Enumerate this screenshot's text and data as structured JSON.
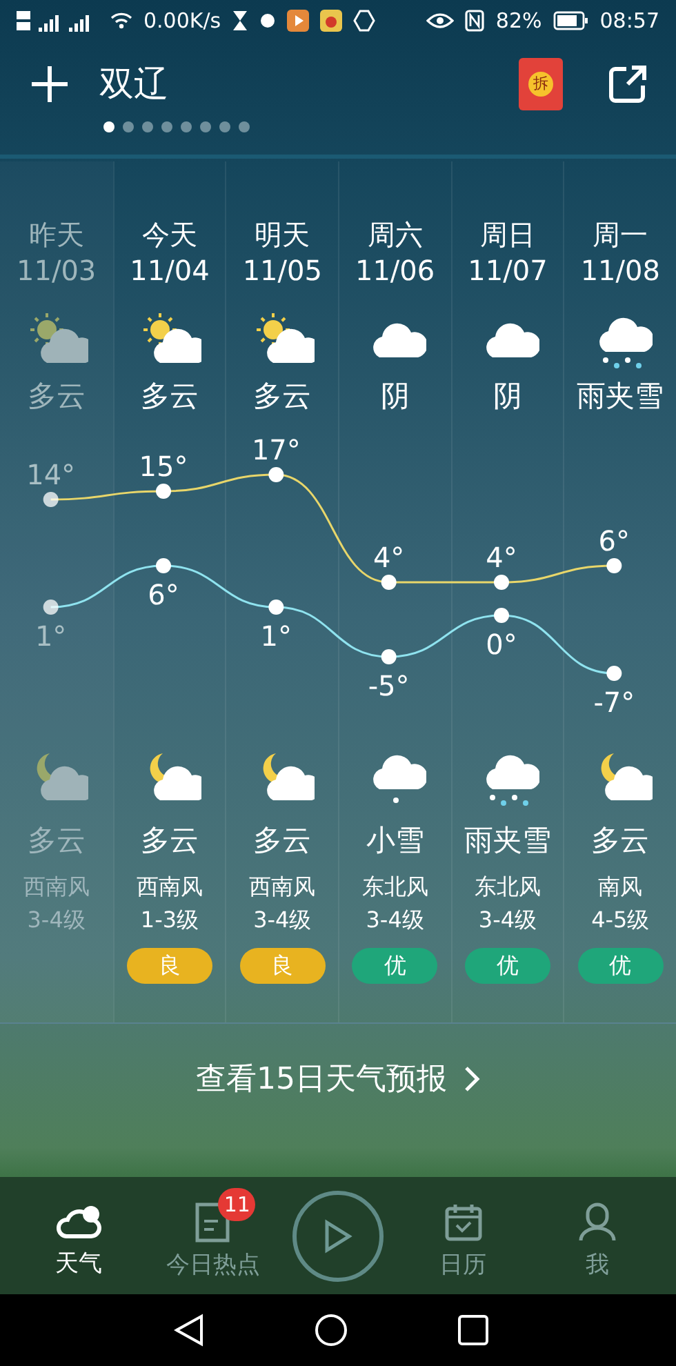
{
  "status_bar": {
    "speed": "0.00K/s",
    "battery": "82%",
    "time": "08:57"
  },
  "header": {
    "city": "双辽",
    "red_packet": "拆",
    "pages": [
      {
        "selected": true
      },
      {
        "selected": false
      },
      {
        "selected": false
      },
      {
        "selected": false
      },
      {
        "selected": false
      },
      {
        "selected": false
      },
      {
        "selected": false
      },
      {
        "selected": false
      }
    ]
  },
  "days": [
    {
      "name": "昨天",
      "date": "11/03",
      "past": true,
      "day_icon": {
        "kind": "sun_cloud"
      },
      "day_weather": "多云",
      "night_icon": {
        "kind": "moon_cloud"
      },
      "night_weather": "多云",
      "wind": "西南风",
      "wind_level": "3-4级"
    },
    {
      "name": "今天",
      "date": "11/04",
      "past": false,
      "day_icon": {
        "kind": "sun_cloud"
      },
      "day_weather": "多云",
      "night_icon": {
        "kind": "moon_cloud"
      },
      "night_weather": "多云",
      "wind": "西南风",
      "wind_level": "1-3级",
      "aqi": {
        "label": "良",
        "color": "#e8b320"
      }
    },
    {
      "name": "明天",
      "date": "11/05",
      "past": false,
      "day_icon": {
        "kind": "sun_cloud"
      },
      "day_weather": "多云",
      "night_icon": {
        "kind": "moon_cloud"
      },
      "night_weather": "多云",
      "wind": "西南风",
      "wind_level": "3-4级",
      "aqi": {
        "label": "良",
        "color": "#e8b320"
      }
    },
    {
      "name": "周六",
      "date": "11/06",
      "past": false,
      "day_icon": {
        "kind": "cloud"
      },
      "day_weather": "阴",
      "night_icon": {
        "kind": "snow"
      },
      "night_weather": "小雪",
      "wind": "东北风",
      "wind_level": "3-4级",
      "aqi": {
        "label": "优",
        "color": "#1fa67a"
      }
    },
    {
      "name": "周日",
      "date": "11/07",
      "past": false,
      "day_icon": {
        "kind": "cloud"
      },
      "day_weather": "阴",
      "night_icon": {
        "kind": "sleet"
      },
      "night_weather": "雨夹雪",
      "wind": "东北风",
      "wind_level": "3-4级",
      "aqi": {
        "label": "优",
        "color": "#1fa67a"
      }
    },
    {
      "name": "周一",
      "date": "11/08",
      "past": false,
      "day_icon": {
        "kind": "sleet"
      },
      "day_weather": "雨夹雪",
      "night_icon": {
        "kind": "moon_cloud"
      },
      "night_weather": "多云",
      "wind": "南风",
      "wind_level": "4-5级",
      "aqi": {
        "label": "优",
        "color": "#1fa67a"
      }
    }
  ],
  "chart_data": {
    "type": "line",
    "series": [
      {
        "color": "#e8d66a",
        "marker": "circle",
        "values": [
          14,
          15,
          17,
          4,
          4,
          6
        ],
        "value_labels": [
          "14°",
          "15°",
          "17°",
          "4°",
          "4°",
          "6°"
        ]
      },
      {
        "color": "#8fe3ef",
        "marker": "circle",
        "values": [
          1,
          6,
          1,
          -5,
          0,
          -7
        ],
        "value_labels": [
          "1°",
          "6°",
          "1°",
          "-5°",
          "0°",
          "-7°"
        ]
      }
    ]
  },
  "forecast_link": "查看15日天气预报",
  "bottom_nav": [
    {
      "label": "天气",
      "kind": "weather",
      "selected": true
    },
    {
      "label": "今日热点",
      "kind": "news",
      "selected": false,
      "badge": "11"
    },
    {
      "kind": "play",
      "selected": false
    },
    {
      "label": "日历",
      "kind": "calendar",
      "selected": false
    },
    {
      "label": "我",
      "kind": "profile",
      "selected": false
    }
  ]
}
